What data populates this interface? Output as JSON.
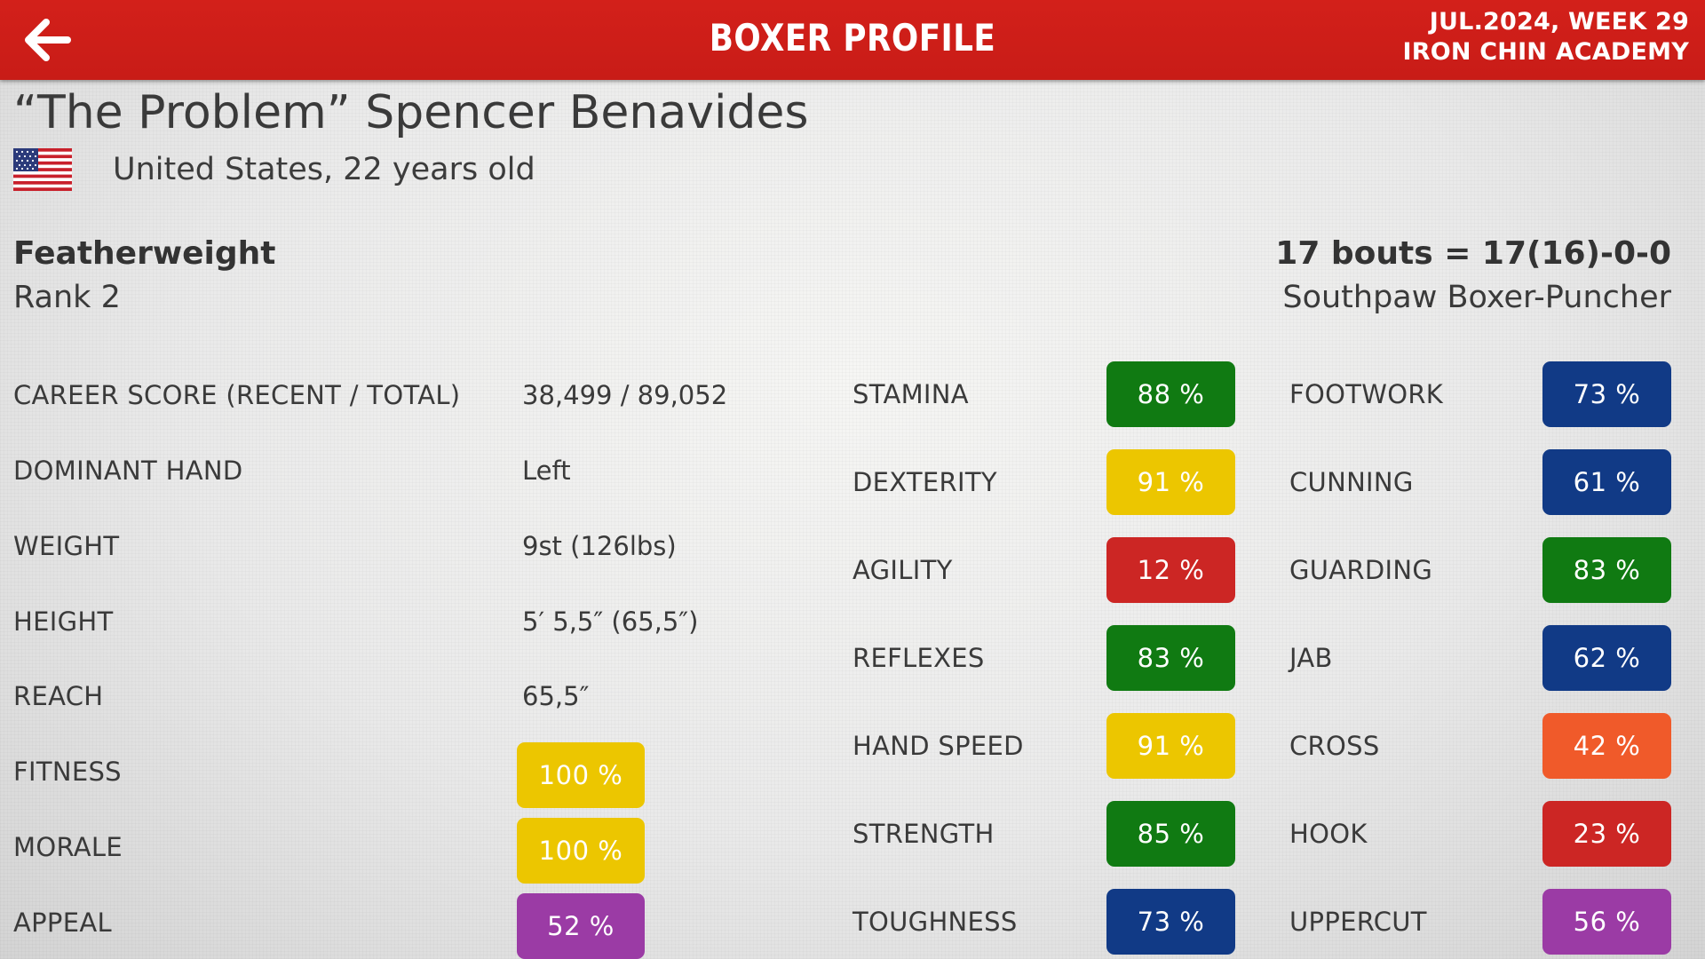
{
  "header": {
    "title": "BOXER PROFILE",
    "date": "JUL.2024, WEEK 29",
    "academy": "IRON CHIN ACADEMY",
    "back_icon": "arrow-left-icon",
    "bar_color": "#cf1f19"
  },
  "boxer": {
    "name": "“The Problem” Spencer Benavides",
    "flag_icon": "us-flag-icon",
    "nationality_age": "United States, 22 years old",
    "weight_class": "Featherweight",
    "rank": "Rank 2",
    "record": "17 bouts = 17(16)-0-0",
    "style": "Southpaw Boxer-Puncher"
  },
  "info": [
    {
      "label": "CAREER SCORE (RECENT / TOTAL)",
      "value": "38,499 / 89,052"
    },
    {
      "label": "DOMINANT HAND",
      "value": "Left"
    },
    {
      "label": "WEIGHT",
      "value": "9st (126lbs)"
    },
    {
      "label": "HEIGHT",
      "value": "5′ 5,5″ (65,5″)"
    },
    {
      "label": "REACH",
      "value": "65,5″"
    },
    {
      "label": "FITNESS",
      "value": "100 %",
      "color": "#ecc600"
    },
    {
      "label": "MORALE",
      "value": "100 %",
      "color": "#ecc600"
    },
    {
      "label": "APPEAL",
      "value": "52 %",
      "color": "#9b3ba5"
    }
  ],
  "attributes_left": [
    {
      "label": "STAMINA",
      "value": "88 %",
      "color": "#107a12"
    },
    {
      "label": "DEXTERITY",
      "value": "91 %",
      "color": "#ecc600"
    },
    {
      "label": "AGILITY",
      "value": "12 %",
      "color": "#cc2624"
    },
    {
      "label": "REFLEXES",
      "value": "83 %",
      "color": "#107a12"
    },
    {
      "label": "HAND SPEED",
      "value": "91 %",
      "color": "#ecc600"
    },
    {
      "label": "STRENGTH",
      "value": "85 %",
      "color": "#107a12"
    },
    {
      "label": "TOUGHNESS",
      "value": "73 %",
      "color": "#113a86"
    }
  ],
  "attributes_right": [
    {
      "label": "FOOTWORK",
      "value": "73 %",
      "color": "#113a86"
    },
    {
      "label": "CUNNING",
      "value": "61 %",
      "color": "#113a86"
    },
    {
      "label": "GUARDING",
      "value": "83 %",
      "color": "#107a12"
    },
    {
      "label": "JAB",
      "value": "62 %",
      "color": "#113a86"
    },
    {
      "label": "CROSS",
      "value": "42 %",
      "color": "#f05a2a"
    },
    {
      "label": "HOOK",
      "value": "23 %",
      "color": "#cc2624"
    },
    {
      "label": "UPPERCUT",
      "value": "56 %",
      "color": "#9b3ba5"
    }
  ]
}
